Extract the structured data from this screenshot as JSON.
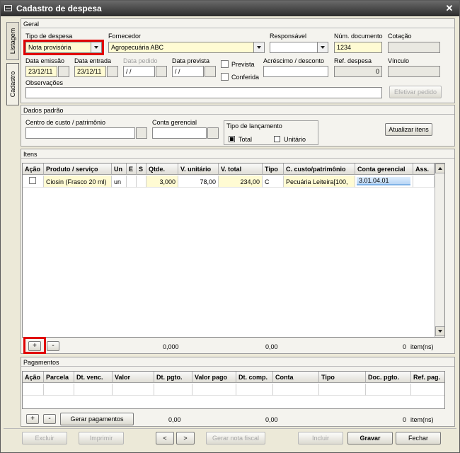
{
  "window": {
    "title": "Cadastro de despesa",
    "close_glyph": "✕"
  },
  "sidetabs": {
    "listagem": "Listagem",
    "cadastro": "Cadastro"
  },
  "geral": {
    "section_title": "Geral",
    "tipo_despesa": {
      "label": "Tipo de despesa",
      "value": "Nota provisória"
    },
    "fornecedor": {
      "label": "Fornecedor",
      "value": "Agropecuária ABC"
    },
    "responsavel": {
      "label": "Responsável",
      "value": ""
    },
    "num_documento": {
      "label": "Núm. documento",
      "value": "1234"
    },
    "cotacao": {
      "label": "Cotação",
      "value": ""
    },
    "data_emissao": {
      "label": "Data emissão",
      "value": "23/12/11"
    },
    "data_entrada": {
      "label": "Data entrada",
      "value": "23/12/11"
    },
    "data_pedido": {
      "label": "Data pedido",
      "value": " / /"
    },
    "data_prevista": {
      "label": "Data prevista",
      "value": " / /"
    },
    "prevista": {
      "label": "Prevista",
      "checked": false
    },
    "conferida": {
      "label": "Conferida",
      "checked": false
    },
    "acrescimo": {
      "label": "Acréscimo / desconto",
      "value": ""
    },
    "ref_despesa": {
      "label": "Ref. despesa",
      "value": "0"
    },
    "vinculo": {
      "label": "Vínculo",
      "value": ""
    },
    "observacoes": {
      "label": "Observações",
      "value": ""
    },
    "efetivar_pedido": "Efetivar pedido"
  },
  "dados_padrao": {
    "section_title": "Dados padrão",
    "centro_custo": {
      "label": "Centro de custo / patrimônio",
      "value": ""
    },
    "conta_gerencial": {
      "label": "Conta gerencial",
      "value": ""
    },
    "tipo_lancamento": {
      "label": "Tipo de lançamento",
      "options": [
        "Total",
        "Unitário"
      ],
      "selected": "Total"
    },
    "atualizar_itens": "Atualizar itens"
  },
  "itens": {
    "section_title": "Itens",
    "columns": [
      "Ação",
      "Produto / serviço",
      "Un",
      "E",
      "S",
      "Qtde.",
      "V. unitário",
      "V. total",
      "Tipo",
      "C. custo/patrimônio",
      "Conta gerencial",
      "Ass."
    ],
    "rows": [
      {
        "produto": "Ciosin (Frasco 20 ml)",
        "un": "un",
        "e": "",
        "s": "",
        "qtde": "3,000",
        "v_unitario": "78,00",
        "v_total": "234,00",
        "tipo": "C",
        "c_custo": "Pecuária Leiteira[100,",
        "conta": "3.01.04.01",
        "ass": ""
      }
    ],
    "add_glyph": "+",
    "remove_glyph": "-",
    "total_qtde": "0,000",
    "total_valor": "0,00",
    "count": "0",
    "count_label": "item(ns)"
  },
  "pagamentos": {
    "section_title": "Pagamentos",
    "columns": [
      "Ação",
      "Parcela",
      "Dt. venc.",
      "Valor",
      "Dt. pgto.",
      "Valor pago",
      "Dt. comp.",
      "Conta",
      "Tipo",
      "Doc. pgto.",
      "Ref. pag."
    ],
    "add_glyph": "+",
    "remove_glyph": "-",
    "gerar_pagamentos": "Gerar pagamentos",
    "total_valor": "0,00",
    "total_pago": "0,00",
    "count": "0",
    "count_label": "item(ns)"
  },
  "footer": {
    "excluir": "Excluir",
    "imprimir": "Imprimir",
    "prev_glyph": "<",
    "next_glyph": ">",
    "gerar_nota": "Gerar nota fiscal",
    "incluir": "Incluir",
    "gravar": "Gravar",
    "fechar": "Fechar"
  },
  "colors": {
    "highlight": "#e00000",
    "required": "#fffbd3",
    "titlebar": "#2c2c2c"
  }
}
